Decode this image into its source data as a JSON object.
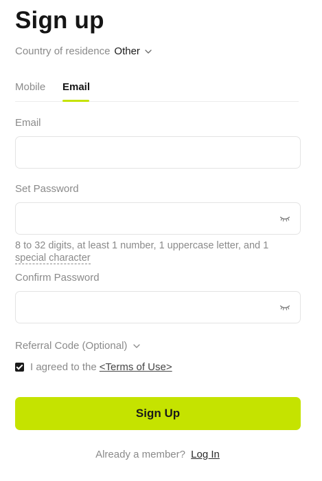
{
  "page": {
    "title": "Sign up"
  },
  "country": {
    "label": "Country of residence",
    "value": "Other"
  },
  "tabs": [
    {
      "label": "Mobile",
      "active": false
    },
    {
      "label": "Email",
      "active": true
    }
  ],
  "form": {
    "email_label": "Email",
    "email_value": "",
    "password_label": "Set Password",
    "password_value": "",
    "password_hint_main": "8 to 32 digits, at least 1 number, 1 uppercase letter, and 1",
    "password_hint_dashed": "special character",
    "confirm_label": "Confirm Password",
    "confirm_value": "",
    "referral_label": "Referral Code (Optional)",
    "agree_text": "I agreed to the",
    "terms_link": "<Terms of Use>",
    "agree_checked": true,
    "submit_label": "Sign Up"
  },
  "footer": {
    "member_text": "Already a member?",
    "login_link": "Log In"
  },
  "icons": {
    "country_dropdown": "chevron-down-icon",
    "password_visibility": "eye-closed-icon",
    "confirm_visibility": "eye-closed-icon",
    "referral_dropdown": "chevron-down-icon",
    "checkbox": "checkbox-checked-icon"
  },
  "colors": {
    "accent": "#c5e300",
    "muted_text": "#8a8a8a",
    "primary_text": "#151515",
    "border": "#e3e3e3"
  }
}
